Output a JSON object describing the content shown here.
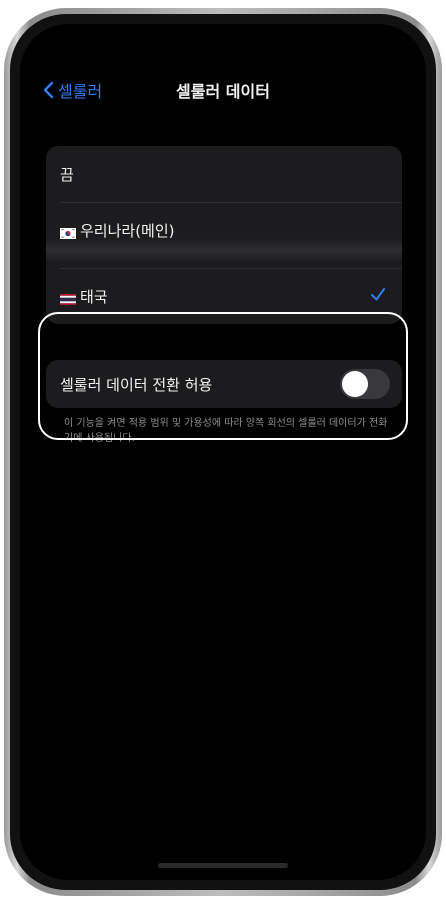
{
  "nav": {
    "back_label": "셀룰러",
    "title": "셀룰러 데이터"
  },
  "options": [
    {
      "label": "끔",
      "selected": false,
      "flag": ""
    },
    {
      "label": "우리나라(메인)",
      "selected": false,
      "flag": "korea-flag-icon"
    },
    {
      "label": "태국",
      "selected": true,
      "flag": "thailand-flag-icon"
    }
  ],
  "toggle": {
    "label": "셀룰러 데이터 전환 허용",
    "on": false
  },
  "footnote": "이 기능을 켜면 적용 범위 및 가용성에 따라 양쪽 회선의 셀룰러 데이터가 전화기에 사용됩니다.",
  "colors": {
    "accent": "#2f7cf6",
    "background": "#000000",
    "group_bg": "#1c1c1e",
    "highlight": "#ffffff"
  }
}
